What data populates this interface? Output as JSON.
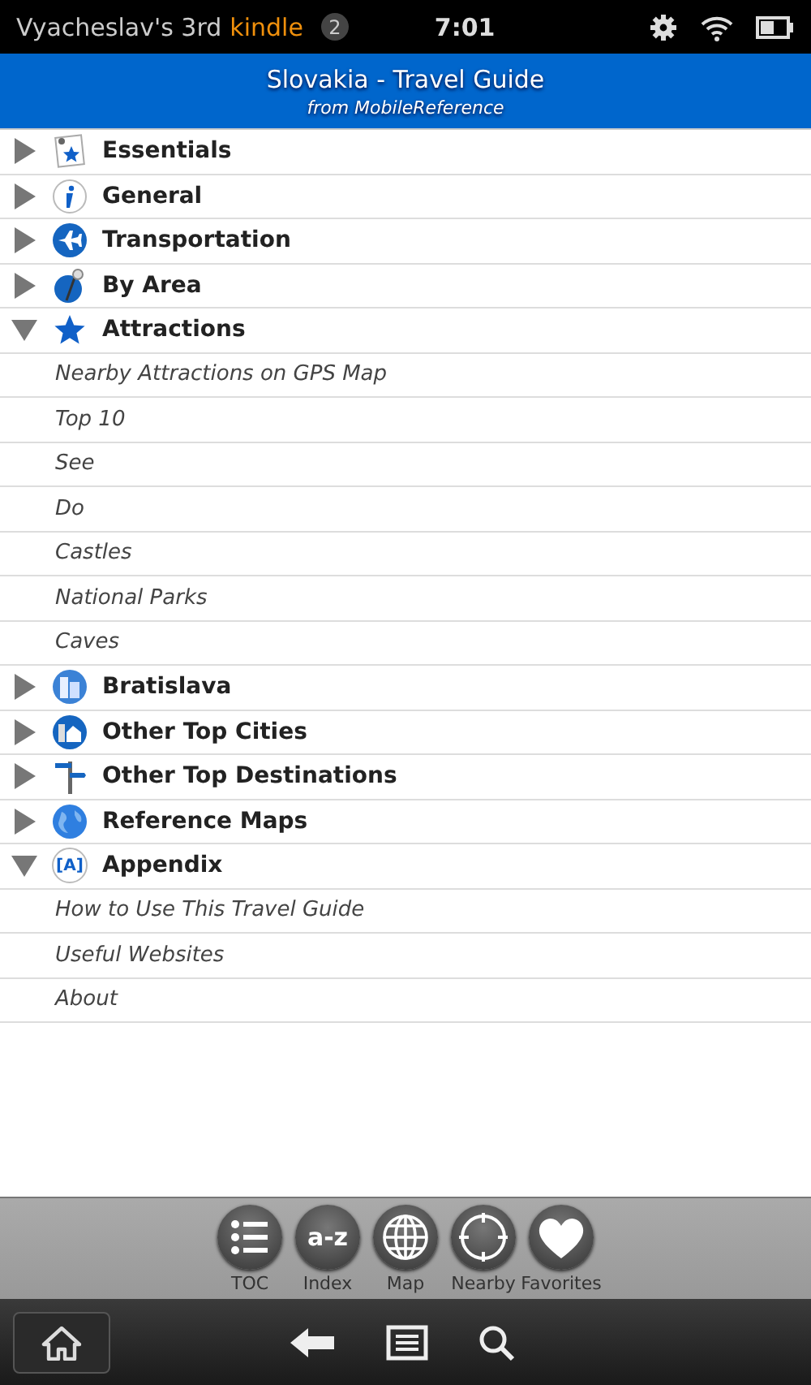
{
  "status_bar": {
    "device_name": "Vyacheslav's 3rd",
    "brand": "kindle",
    "notification_count": "2",
    "time": "7:01"
  },
  "header": {
    "title": "Slovakia - Travel Guide",
    "subtitle": "from MobileReference"
  },
  "sections": [
    {
      "label": "Essentials",
      "expanded": false
    },
    {
      "label": "General",
      "expanded": false
    },
    {
      "label": "Transportation",
      "expanded": false
    },
    {
      "label": "By Area",
      "expanded": false
    },
    {
      "label": "Attractions",
      "expanded": true,
      "children": [
        {
          "label": "Nearby Attractions on GPS Map"
        },
        {
          "label": "Top 10"
        },
        {
          "label": "See"
        },
        {
          "label": "Do"
        },
        {
          "label": "Castles"
        },
        {
          "label": "National Parks"
        },
        {
          "label": "Caves"
        }
      ]
    },
    {
      "label": "Bratislava",
      "expanded": false
    },
    {
      "label": "Other Top Cities",
      "expanded": false
    },
    {
      "label": "Other Top Destinations",
      "expanded": false
    },
    {
      "label": "Reference Maps",
      "expanded": false
    },
    {
      "label": "Appendix",
      "expanded": true,
      "icon_text": "[A]",
      "children": [
        {
          "label": "How to Use This Travel Guide"
        },
        {
          "label": "Useful Websites"
        },
        {
          "label": "About"
        }
      ]
    }
  ],
  "toolbar": [
    {
      "label": "TOC"
    },
    {
      "label": "Index",
      "icon_text": "a-z"
    },
    {
      "label": "Map"
    },
    {
      "label": "Nearby"
    },
    {
      "label": "Favorites"
    }
  ]
}
